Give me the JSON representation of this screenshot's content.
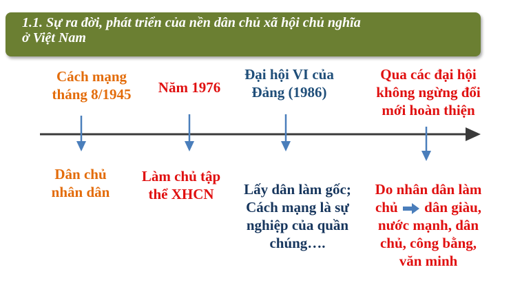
{
  "title": {
    "line1": "1.1. Sự ra đời, phát triển của nền dân chủ xã hội chủ nghĩa",
    "line2": "ở Việt Nam"
  },
  "milestones": [
    {
      "top_line1": "Cách mạng",
      "top_line2": "tháng 8/1945",
      "bottom_line1": "Dân chủ",
      "bottom_line2": "nhân dân"
    },
    {
      "top_line1": "Năm 1976",
      "bottom_line1": "Làm chủ tập",
      "bottom_line2": "thể XHCN"
    },
    {
      "top_line1": "Đại hội VI của",
      "top_line2": "Đảng (1986)",
      "bottom_line1": "Lấy dân làm gốc;",
      "bottom_line2": "Cách mạng là sự",
      "bottom_line3": "nghiệp của quần",
      "bottom_line4": "chúng…."
    },
    {
      "top_line1": "Qua các đại hội",
      "top_line2": "không ngừng đổi",
      "top_line3": "mới hoàn thiện",
      "bottom_line1": "Do nhân dân làm",
      "bottom_line2a": "chủ",
      "bottom_line2b": "dân giàu,",
      "bottom_line3": "nước mạnh, dân",
      "bottom_line4": "chủ, công bằng,",
      "bottom_line5": "văn minh"
    }
  ],
  "colors": {
    "banner": "#6b7f32",
    "timeline": "#3a3a3a",
    "arrow": "#4a7ebb",
    "orange": "#e36c0a",
    "red": "#e01010",
    "blue": "#1f4e79"
  },
  "icons": {
    "timeline_arrow": "arrow-right-icon",
    "event_marker": "arrow-down-icon",
    "inline_arrow": "block-arrow-right-icon"
  }
}
